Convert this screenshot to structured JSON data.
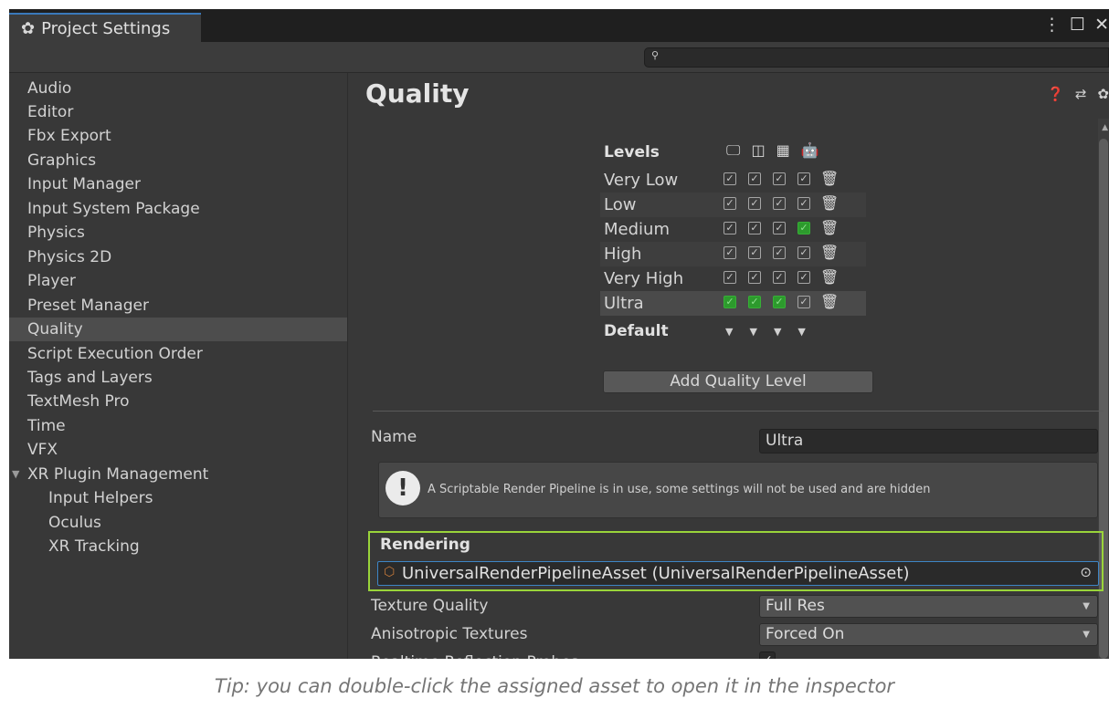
{
  "window": {
    "tab_title": "Project Settings",
    "tab_icon": "gear-icon",
    "controls": [
      "kebab-menu-icon",
      "maximize-icon",
      "close-icon"
    ]
  },
  "search": {
    "placeholder": "",
    "icon": "search-icon"
  },
  "sidebar": {
    "items": [
      {
        "label": "Audio"
      },
      {
        "label": "Editor"
      },
      {
        "label": "Fbx Export"
      },
      {
        "label": "Graphics"
      },
      {
        "label": "Input Manager"
      },
      {
        "label": "Input System Package"
      },
      {
        "label": "Physics"
      },
      {
        "label": "Physics 2D"
      },
      {
        "label": "Player"
      },
      {
        "label": "Preset Manager"
      },
      {
        "label": "Quality",
        "selected": true
      },
      {
        "label": "Script Execution Order"
      },
      {
        "label": "Tags and Layers"
      },
      {
        "label": "TextMesh Pro"
      },
      {
        "label": "Time"
      },
      {
        "label": "VFX"
      },
      {
        "label": "XR Plugin Management",
        "expanded": true
      },
      {
        "label": "Input Helpers",
        "child": true
      },
      {
        "label": "Oculus",
        "child": true
      },
      {
        "label": "XR Tracking",
        "child": true
      }
    ]
  },
  "main": {
    "title": "Quality",
    "header_icons": [
      "help-icon",
      "preset-icon",
      "settings-icon"
    ],
    "levels": {
      "header": "Levels",
      "platforms": [
        "standalone-icon",
        "switch-icon",
        "windows-store-icon",
        "android-icon"
      ],
      "rows": [
        {
          "name": "Very Low",
          "checks": [
            "on",
            "on",
            "on",
            "on"
          ],
          "highlight": [
            false,
            false,
            false,
            false
          ]
        },
        {
          "name": "Low",
          "checks": [
            "on",
            "on",
            "on",
            "on"
          ],
          "highlight": [
            false,
            false,
            false,
            false
          ]
        },
        {
          "name": "Medium",
          "checks": [
            "on",
            "on",
            "on",
            "on"
          ],
          "highlight": [
            false,
            false,
            false,
            true
          ]
        },
        {
          "name": "High",
          "checks": [
            "on",
            "on",
            "on",
            "on"
          ],
          "highlight": [
            false,
            false,
            false,
            false
          ]
        },
        {
          "name": "Very High",
          "checks": [
            "on",
            "on",
            "on",
            "on"
          ],
          "highlight": [
            false,
            false,
            false,
            false
          ]
        },
        {
          "name": "Ultra",
          "checks": [
            "on",
            "on",
            "on",
            "on"
          ],
          "highlight": [
            true,
            true,
            true,
            false
          ]
        }
      ],
      "default_label": "Default",
      "add_button": "Add Quality Level"
    },
    "name_label": "Name",
    "name_value": "Ultra",
    "help_text": "A Scriptable Render Pipeline is in use, some settings will not be used and are hidden",
    "rendering": {
      "label": "Rendering",
      "asset_value": "UniversalRenderPipelineAsset (UniversalRenderPipelineAsset)"
    },
    "properties": [
      {
        "label": "Texture Quality",
        "value": "Full Res"
      },
      {
        "label": "Anisotropic Textures",
        "value": "Forced On"
      }
    ],
    "partial_property": {
      "label": "Realtime Reflection Probes",
      "value": "✓"
    }
  },
  "caption": "Tip: you can double-click the assigned asset to open it in the inspector",
  "colors": {
    "accent_green": "#9ad43a",
    "selected_blue": "#3d85c6",
    "check_green": "#2d9a2d"
  }
}
